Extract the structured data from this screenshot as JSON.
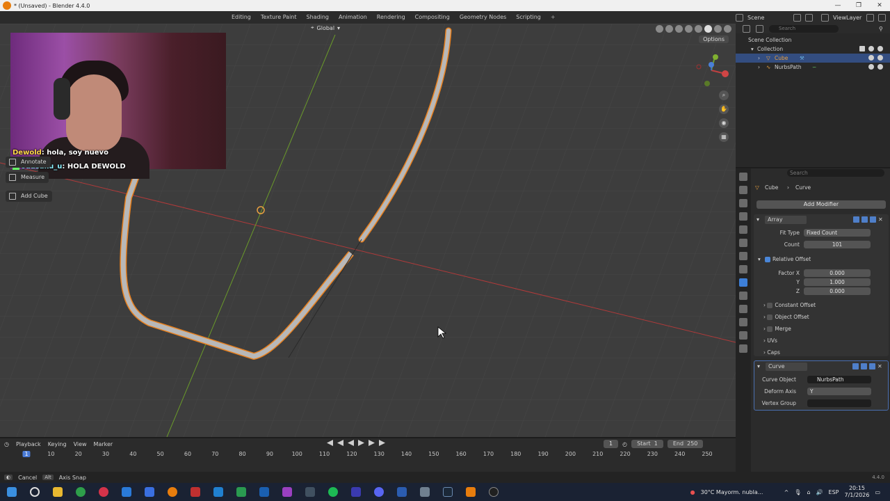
{
  "window": {
    "title": "* (Unsaved) - Blender 4.4.0"
  },
  "workspace_tabs": [
    "Editing",
    "Texture Paint",
    "Shading",
    "Animation",
    "Rendering",
    "Compositing",
    "Geometry Nodes",
    "Scripting"
  ],
  "top_right": {
    "scene": "Scene",
    "view_layer": "ViewLayer"
  },
  "viewport": {
    "orientation": "Global",
    "options_label": "Options",
    "tools": [
      "Annotate",
      "Measure",
      "Add Cube"
    ]
  },
  "chat": [
    {
      "user": "Dewold",
      "message": "hola, soy nuevo"
    },
    {
      "user": "odasaku_u",
      "message": "HOLA DEWOLD"
    }
  ],
  "outliner": {
    "search_placeholder": "Search",
    "root": "Scene Collection",
    "collection": "Collection",
    "items": [
      "Cube",
      "NurbsPath"
    ]
  },
  "properties": {
    "search_placeholder": "Search",
    "breadcrumb": {
      "object": "Cube",
      "modifier": "Curve"
    },
    "add_modifier": "Add Modifier",
    "array": {
      "name": "Array",
      "fit_type_label": "Fit Type",
      "fit_type": "Fixed Count",
      "count_label": "Count",
      "count": "101",
      "relative_offset_label": "Relative Offset",
      "factor_x_label": "Factor X",
      "factor_x": "0.000",
      "y_label": "Y",
      "y": "1.000",
      "z_label": "Z",
      "z": "0.000",
      "subsections": [
        "Constant Offset",
        "Object Offset",
        "Merge",
        "UVs",
        "Caps"
      ]
    },
    "curve": {
      "name": "Curve",
      "curve_object_label": "Curve Object",
      "curve_object": "NurbsPath",
      "deform_axis_label": "Deform Axis",
      "deform_axis": "Y",
      "vertex_group_label": "Vertex Group"
    }
  },
  "timeline": {
    "menus": [
      "Playback",
      "Keying",
      "View",
      "Marker"
    ],
    "current_frame": "1",
    "start_label": "Start",
    "start": "1",
    "end_label": "End",
    "end": "250",
    "ticks": [
      "1",
      "10",
      "20",
      "30",
      "40",
      "50",
      "60",
      "70",
      "80",
      "90",
      "100",
      "110",
      "120",
      "130",
      "140",
      "150",
      "160",
      "170",
      "180",
      "190",
      "200",
      "210",
      "220",
      "230",
      "240",
      "250"
    ]
  },
  "statusbar": {
    "cancel": "Cancel",
    "alt_key": "Alt",
    "axis_snap": "Axis Snap",
    "version": "4.4.0"
  },
  "taskbar": {
    "weather": "30°C  Mayorm. nubla...",
    "lang": "ESP",
    "time": "20:15",
    "date": "7/1/2026"
  },
  "colors": {
    "viewport_bg": "#3d3d3d",
    "selection": "#334d80",
    "accent": "#4a86d8",
    "x_axis": "#b03a3a",
    "y_axis": "#6a9a2a",
    "object_outline": "#e8801e"
  }
}
